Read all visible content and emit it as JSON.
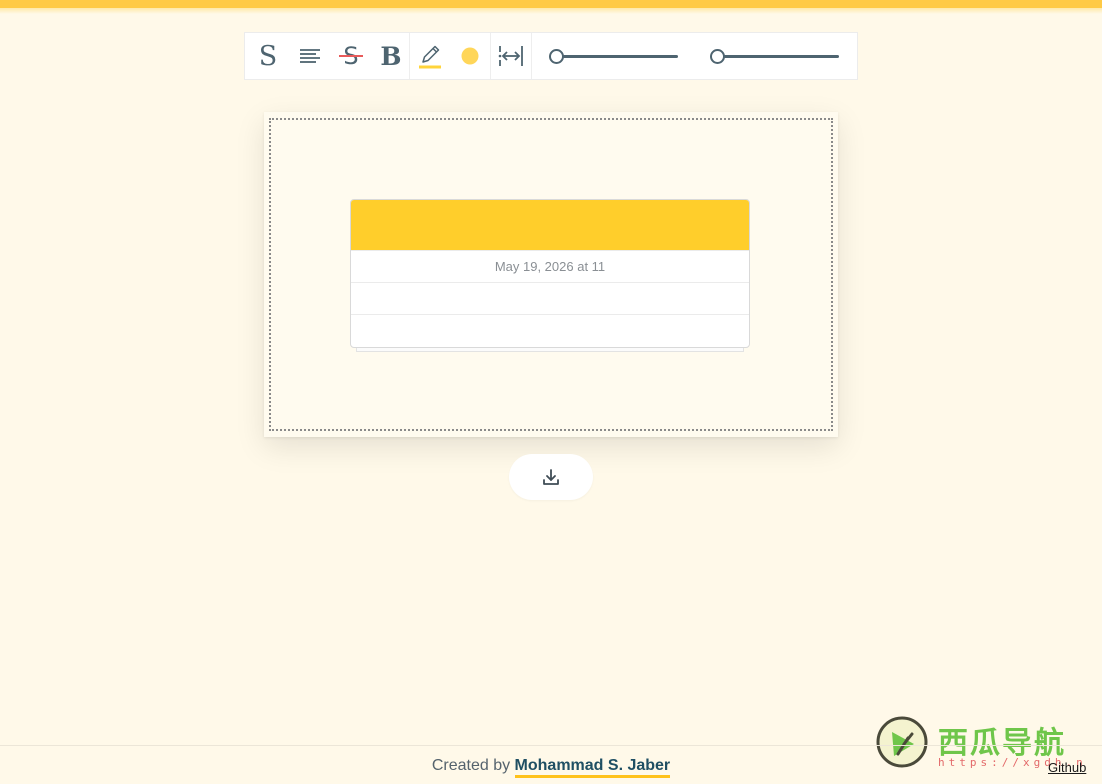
{
  "toolbar": {
    "tools": [
      {
        "name": "font-family",
        "icon": "serif-s-icon",
        "glyph": "S"
      },
      {
        "name": "text-align",
        "icon": "align-lines-icon"
      },
      {
        "name": "strikethrough",
        "icon": "strikethrough-icon",
        "glyph": "S"
      },
      {
        "name": "bold",
        "icon": "bold-icon",
        "glyph": "B"
      },
      {
        "name": "highlight",
        "icon": "pencil-icon"
      },
      {
        "name": "color",
        "icon": "color-dot-icon"
      },
      {
        "name": "width",
        "icon": "width-arrows-icon"
      }
    ],
    "sliders": [
      {
        "name": "slider-1",
        "value": 0
      },
      {
        "name": "slider-2",
        "value": 0
      }
    ],
    "colors": {
      "icon": "#4e6470",
      "strike": "#e85a5a",
      "highlight": "#ffd43b",
      "dot": "#ffd659"
    }
  },
  "canvas": {
    "table": {
      "header_color": "#ffce2b",
      "rows": [
        "May 19, 2026 at 11",
        "",
        ""
      ]
    }
  },
  "download": {
    "icon": "download-icon"
  },
  "footer": {
    "created_by": "Created by",
    "author": "Mohammad S. Jaber",
    "github": "Github"
  },
  "watermark": {
    "text": "西瓜导航",
    "url": "https://xgdh.n"
  },
  "colors": {
    "background": "#fff9e9",
    "accent": "#ffca45",
    "author_underline": "#ffc21a"
  }
}
